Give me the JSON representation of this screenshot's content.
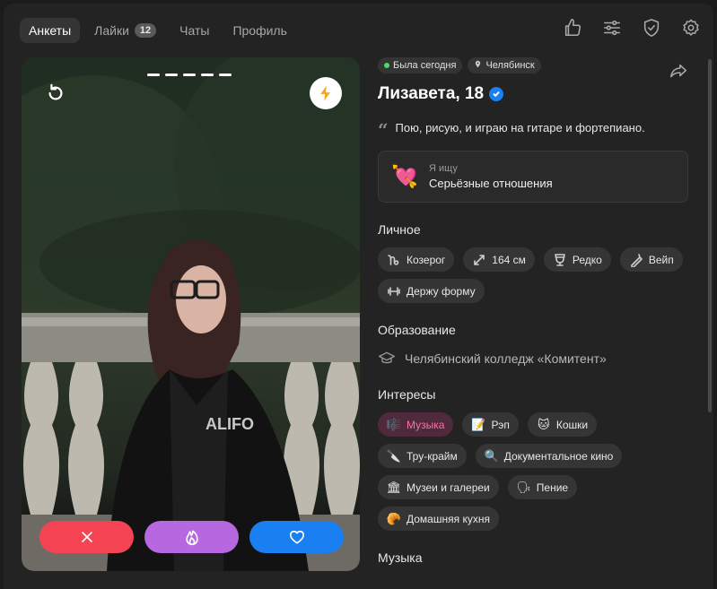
{
  "nav": {
    "tabs": [
      {
        "label": "Анкеты",
        "active": true
      },
      {
        "label": "Лайки",
        "badge": "12"
      },
      {
        "label": "Чаты"
      },
      {
        "label": "Профиль"
      }
    ],
    "icons": [
      "thumbs-up-icon",
      "sliders-icon",
      "shield-icon",
      "gear-icon"
    ]
  },
  "photo": {
    "photo_count": 5,
    "actions": [
      "dislike-x-icon",
      "superlike-flame-icon",
      "like-heart-icon"
    ],
    "colors": {
      "dislike": "#f44352",
      "super": "#b767e0",
      "like": "#1a7ff0",
      "boost": "#f5a623"
    }
  },
  "profile": {
    "status": "Была сегодня",
    "city": "Челябинск",
    "name": "Лизавета, 18",
    "verified": true,
    "bio": "Пою, рисую, и играю на гитаре и фортепиано.",
    "seeking": {
      "label": "Я ищу",
      "value": "Серьёзные отношения",
      "emoji": "💘"
    }
  },
  "personal": {
    "title": "Личное",
    "chips": [
      {
        "label": "Козерог",
        "icon": "capricorn-icon"
      },
      {
        "label": "164 см",
        "icon": "height-icon"
      },
      {
        "label": "Редко",
        "icon": "glass-icon"
      },
      {
        "label": "Вейп",
        "icon": "vape-icon"
      },
      {
        "label": "Держу форму",
        "icon": "dumbbell-icon"
      }
    ]
  },
  "education": {
    "title": "Образование",
    "value": "Челябинский колледж «Комитент»"
  },
  "interests": {
    "title": "Интересы",
    "chips": [
      {
        "label": "Музыка",
        "emoji": "🎼",
        "highlighted": true
      },
      {
        "label": "Рэп",
        "emoji": "📝"
      },
      {
        "label": "Кошки",
        "emoji": "🐱"
      },
      {
        "label": "Тру-крайм",
        "emoji": "🔪"
      },
      {
        "label": "Документальное кино",
        "emoji": "🔍"
      },
      {
        "label": "Музеи и галереи",
        "emoji": "🏛"
      },
      {
        "label": "Пение",
        "emoji": "🗣"
      },
      {
        "label": "Домашняя кухня",
        "emoji": "🥐"
      }
    ]
  },
  "next_section": {
    "title": "Музыка"
  }
}
